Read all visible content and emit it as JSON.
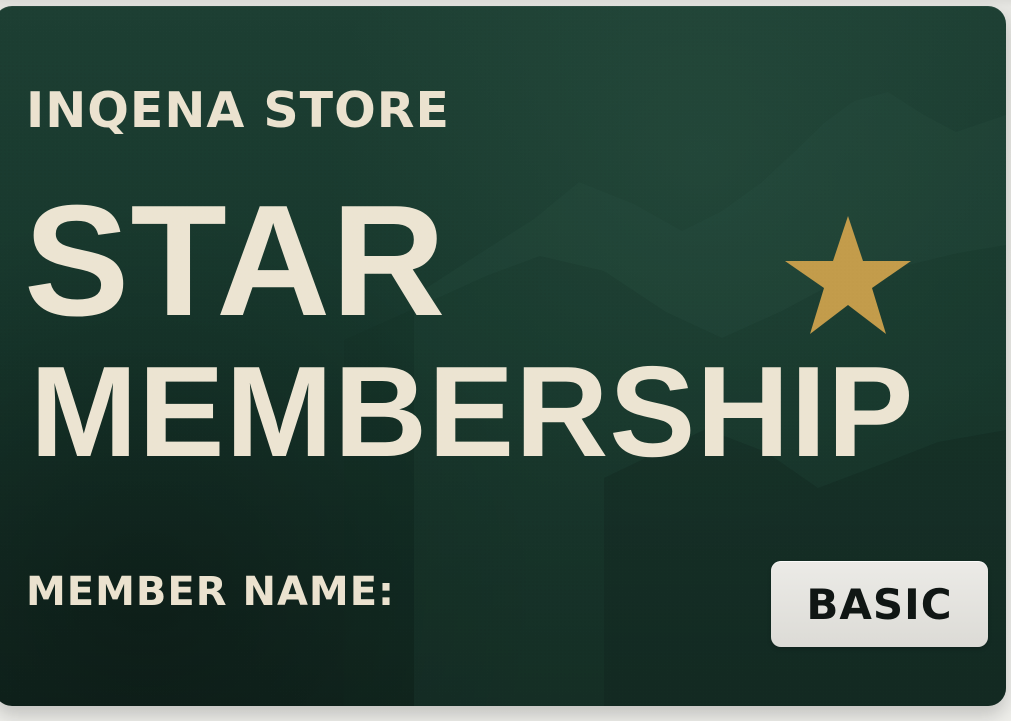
{
  "card": {
    "brand": "INQENA STORE",
    "title_line_1": "STAR",
    "title_line_2": "MEMBERSHIP",
    "member_label": "MEMBER NAME:",
    "tier": "BASIC"
  },
  "icons": {
    "star": "star-icon"
  },
  "colors": {
    "card_green": "#17372c",
    "card_green_dark": "#11261f",
    "text_cream": "#ece4d2",
    "star_gold": "#c39c4b",
    "badge_bg": "#e4e3df",
    "badge_text": "#101614"
  }
}
